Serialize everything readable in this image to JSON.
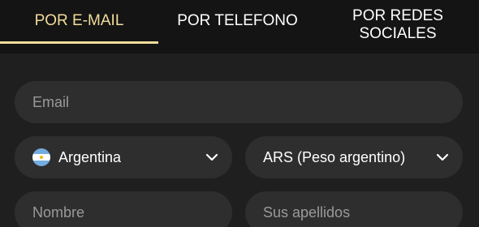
{
  "tabs": [
    {
      "label": "POR E-MAIL",
      "active": true
    },
    {
      "label": "POR TELEFONO",
      "active": false
    },
    {
      "label": "POR REDES SOCIALES",
      "active": false
    }
  ],
  "form": {
    "email_placeholder": "Email",
    "country_value": "Argentina",
    "country_icon": "argentina-flag-icon",
    "currency_value": "ARS (Peso argentino)",
    "nombre_placeholder": "Nombre",
    "apellidos_placeholder": "Sus apellidos"
  },
  "colors": {
    "accent": "#f1dc9a",
    "background": "#1f1f1f",
    "tab_bar": "#141414",
    "field": "#2e2e2e"
  }
}
